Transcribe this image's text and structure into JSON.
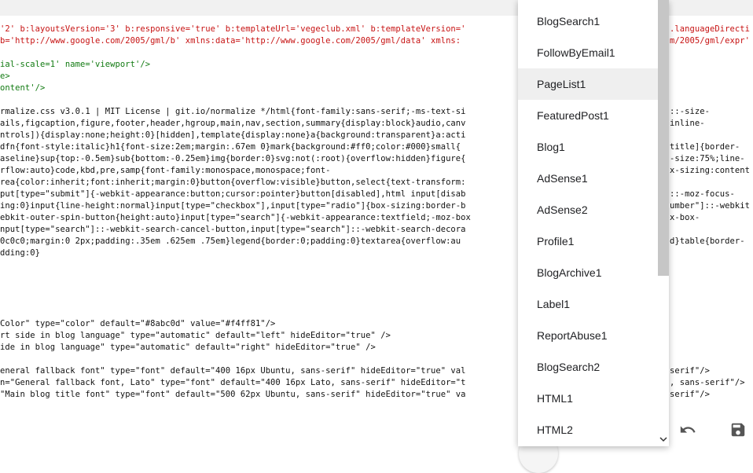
{
  "editor": {
    "lines": [
      {
        "color": "red",
        "text": "'2' b:layoutsVersion='3' b:responsive='true' b:templateUrl='vegeclub.xml' b:templateVersion='"
      },
      {
        "color": "red",
        "text": "b='http://www.google.com/2005/gml/b' xmlns:data='http://www.google.com/2005/gml/data' xmlns:"
      },
      {
        "color": "red",
        "text": ""
      },
      {
        "color": "green",
        "text": "ial-scale=1' name='viewport'/>"
      },
      {
        "color": "green",
        "text": "e>"
      },
      {
        "color": "green",
        "text": "ontent'/>"
      },
      {
        "color": "dark",
        "text": ""
      },
      {
        "color": "dark",
        "text": "rmalize.css v3.0.1 | MIT License | git.io/normalize */html{font-family:sans-serif;-ms-text-si"
      },
      {
        "color": "dark",
        "text": "ails,figcaption,figure,footer,header,hgroup,main,nav,section,summary{display:block}audio,canv"
      },
      {
        "color": "dark",
        "text": "ntrols]){display:none;height:0}[hidden],template{display:none}a{background:transparent}a:acti"
      },
      {
        "color": "dark",
        "text": "dfn{font-style:italic}h1{font-size:2em;margin:.67em 0}mark{background:#ff0;color:#000}small{"
      },
      {
        "color": "dark",
        "text": "aseline}sup{top:-0.5em}sub{bottom:-0.25em}img{border:0}svg:not(:root){overflow:hidden}figure{"
      },
      {
        "color": "dark",
        "text": "rflow:auto}code,kbd,pre,samp{font-family:monospace,monospace;font-"
      },
      {
        "color": "dark",
        "text": "rea{color:inherit;font:inherit;margin:0}button{overflow:visible}button,select{text-transform:"
      },
      {
        "color": "dark",
        "text": "put[type=\"submit\"]{-webkit-appearance:button;cursor:pointer}button[disabled],html input[disab"
      },
      {
        "color": "dark",
        "text": "ing:0}input{line-height:normal}input[type=\"checkbox\"],input[type=\"radio\"]{box-sizing:border-b"
      },
      {
        "color": "dark",
        "text": "ebkit-outer-spin-button{height:auto}input[type=\"search\"]{-webkit-appearance:textfield;-moz-box"
      },
      {
        "color": "dark",
        "text": "nput[type=\"search\"]::-webkit-search-cancel-button,input[type=\"search\"]::-webkit-search-decora"
      },
      {
        "color": "dark",
        "text": "0c0c0;margin:0 2px;padding:.35em .625em .75em}legend{border:0;padding:0}textarea{overflow:au"
      },
      {
        "color": "dark",
        "text": "dding:0}"
      },
      {
        "color": "dark",
        "text": ""
      },
      {
        "color": "dark",
        "text": ""
      },
      {
        "color": "dark",
        "text": ""
      },
      {
        "color": "dark",
        "text": ""
      },
      {
        "color": "dark",
        "text": ""
      },
      {
        "color": "dark",
        "text": "Color\" type=\"color\" default=\"#8abc0d\" value=\"#f4ff81\"/>"
      },
      {
        "color": "dark",
        "text": "rt side in blog language\" type=\"automatic\" default=\"left\" hideEditor=\"true\" />"
      },
      {
        "color": "dark",
        "text": "ide in blog language\" type=\"automatic\" default=\"right\" hideEditor=\"true\" />"
      },
      {
        "color": "dark",
        "text": ""
      },
      {
        "color": "dark",
        "text": "eneral fallback font\" type=\"font\" default=\"400 16px Ubuntu, sans-serif\" hideEditor=\"true\" val"
      },
      {
        "color": "dark",
        "text": "n=\"General fallback font, Lato\" type=\"font\" default=\"400 16px Lato, sans-serif\" hideEditor=\"t"
      },
      {
        "color": "dark",
        "text": "\"Main blog title font\" type=\"font\" default=\"500 62px Ubuntu, sans-serif\" hideEditor=\"true\" va"
      }
    ],
    "right_lines": [
      {
        "color": "red",
        "text": ".languageDirecti"
      },
      {
        "color": "red",
        "text": "m/2005/gml/expr'"
      },
      {
        "color": "dark",
        "text": "::-size-"
      },
      {
        "color": "dark",
        "text": "inline-"
      },
      {
        "color": "dark",
        "text": "title]{border-"
      },
      {
        "color": "dark",
        "text": "-size:75%;line-"
      },
      {
        "color": "dark",
        "text": "x-sizing:content"
      },
      {
        "color": "dark",
        "text": "::-moz-focus-"
      },
      {
        "color": "dark",
        "text": "umber\"]::-webkit"
      },
      {
        "color": "dark",
        "text": "x-box-"
      },
      {
        "color": "dark",
        "text": "d}table{border-"
      },
      {
        "color": "dark",
        "text": "serif\"/>"
      },
      {
        "color": "dark",
        "text": ", sans-serif\"/>"
      },
      {
        "color": "dark",
        "text": "serif\"/>"
      }
    ]
  },
  "dropdown": {
    "items": [
      {
        "label": "BlogSearch1",
        "active": false
      },
      {
        "label": "FollowByEmail1",
        "active": false
      },
      {
        "label": "PageList1",
        "active": true
      },
      {
        "label": "FeaturedPost1",
        "active": false
      },
      {
        "label": "Blog1",
        "active": false
      },
      {
        "label": "AdSense1",
        "active": false
      },
      {
        "label": "AdSense2",
        "active": false
      },
      {
        "label": "Profile1",
        "active": false
      },
      {
        "label": "BlogArchive1",
        "active": false
      },
      {
        "label": "Label1",
        "active": false
      },
      {
        "label": "ReportAbuse1",
        "active": false
      },
      {
        "label": "BlogSearch2",
        "active": false
      },
      {
        "label": "HTML1",
        "active": false
      },
      {
        "label": "HTML2",
        "active": false
      }
    ]
  },
  "toolbar": {
    "icons": [
      "undo-icon",
      "save-icon"
    ]
  },
  "colors": {
    "code_red": "#c71313",
    "code_dark": "#111111",
    "code_green": "#117a11",
    "highlight": "#efefef",
    "scroll_thumb": "#c6c6c6"
  }
}
